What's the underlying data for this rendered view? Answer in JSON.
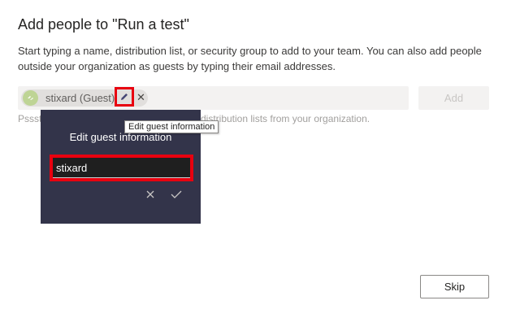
{
  "dialog": {
    "title": "Add people to \"Run a test\"",
    "description": "Start typing a name, distribution list, or security group to add to your team. You can also add people outside your organization as guests by typing their email addresses."
  },
  "people_picker": {
    "chip": {
      "name": "stixard (Guest)",
      "avatar_color": "#bed495",
      "edit_icon": "pencil-icon",
      "remove_icon": "close-icon"
    },
    "add_label": "Add",
    "hint_left": "Pssst",
    "hint_right": "distribution lists from your organization."
  },
  "tooltip": {
    "text": "Edit guest information"
  },
  "edit_popup": {
    "title": "Edit guest information",
    "input_value": "stixard",
    "cancel_icon": "close-icon",
    "confirm_icon": "checkmark-icon"
  },
  "footer": {
    "skip_label": "Skip"
  },
  "colors": {
    "highlight": "#e8000f",
    "popup_bg": "#33344a",
    "input_bg": "#f3f2f1"
  }
}
